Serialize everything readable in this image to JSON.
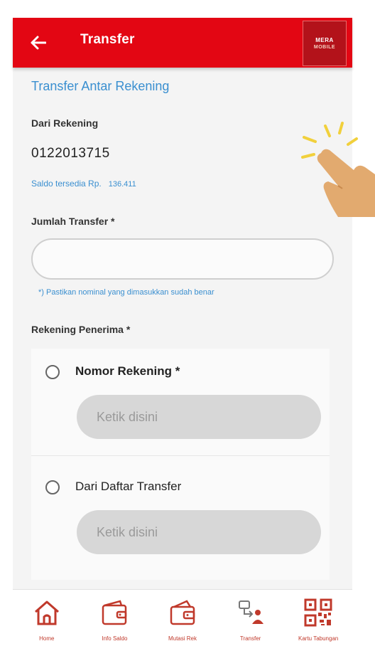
{
  "header": {
    "title": "Transfer",
    "brand_line1": "MERA",
    "brand_line2": "MOBILE"
  },
  "form": {
    "subtitle": "Transfer Antar Rekening",
    "from_label": "Dari Rekening",
    "account_number": "0122013715",
    "balance_label": "Saldo tersedia Rp.",
    "balance_value": "136.411",
    "amount_label": "Jumlah Transfer *",
    "amount_value": "",
    "amount_hint": "*) Pastikan nominal yang dimasukkan sudah benar",
    "recipient_label": "Rekening Penerima *",
    "options": [
      {
        "label": "Nomor Rekening *",
        "placeholder": "Ketik disini"
      },
      {
        "label": "Dari Daftar Transfer",
        "placeholder": "Ketik disini"
      }
    ]
  },
  "bottom_nav": {
    "items": [
      {
        "label": "Home",
        "icon": "home-icon"
      },
      {
        "label": "Info Saldo",
        "icon": "wallet-icon"
      },
      {
        "label": "Mutasi Rek",
        "icon": "wallet-card-icon"
      },
      {
        "label": "Transfer",
        "icon": "transfer-icon"
      },
      {
        "label": "Kartu Tabungan",
        "icon": "qr-code-icon"
      }
    ]
  },
  "colors": {
    "brand_red": "#e30613",
    "link_blue": "#3a8fd0",
    "nav_red": "#c0392b"
  }
}
